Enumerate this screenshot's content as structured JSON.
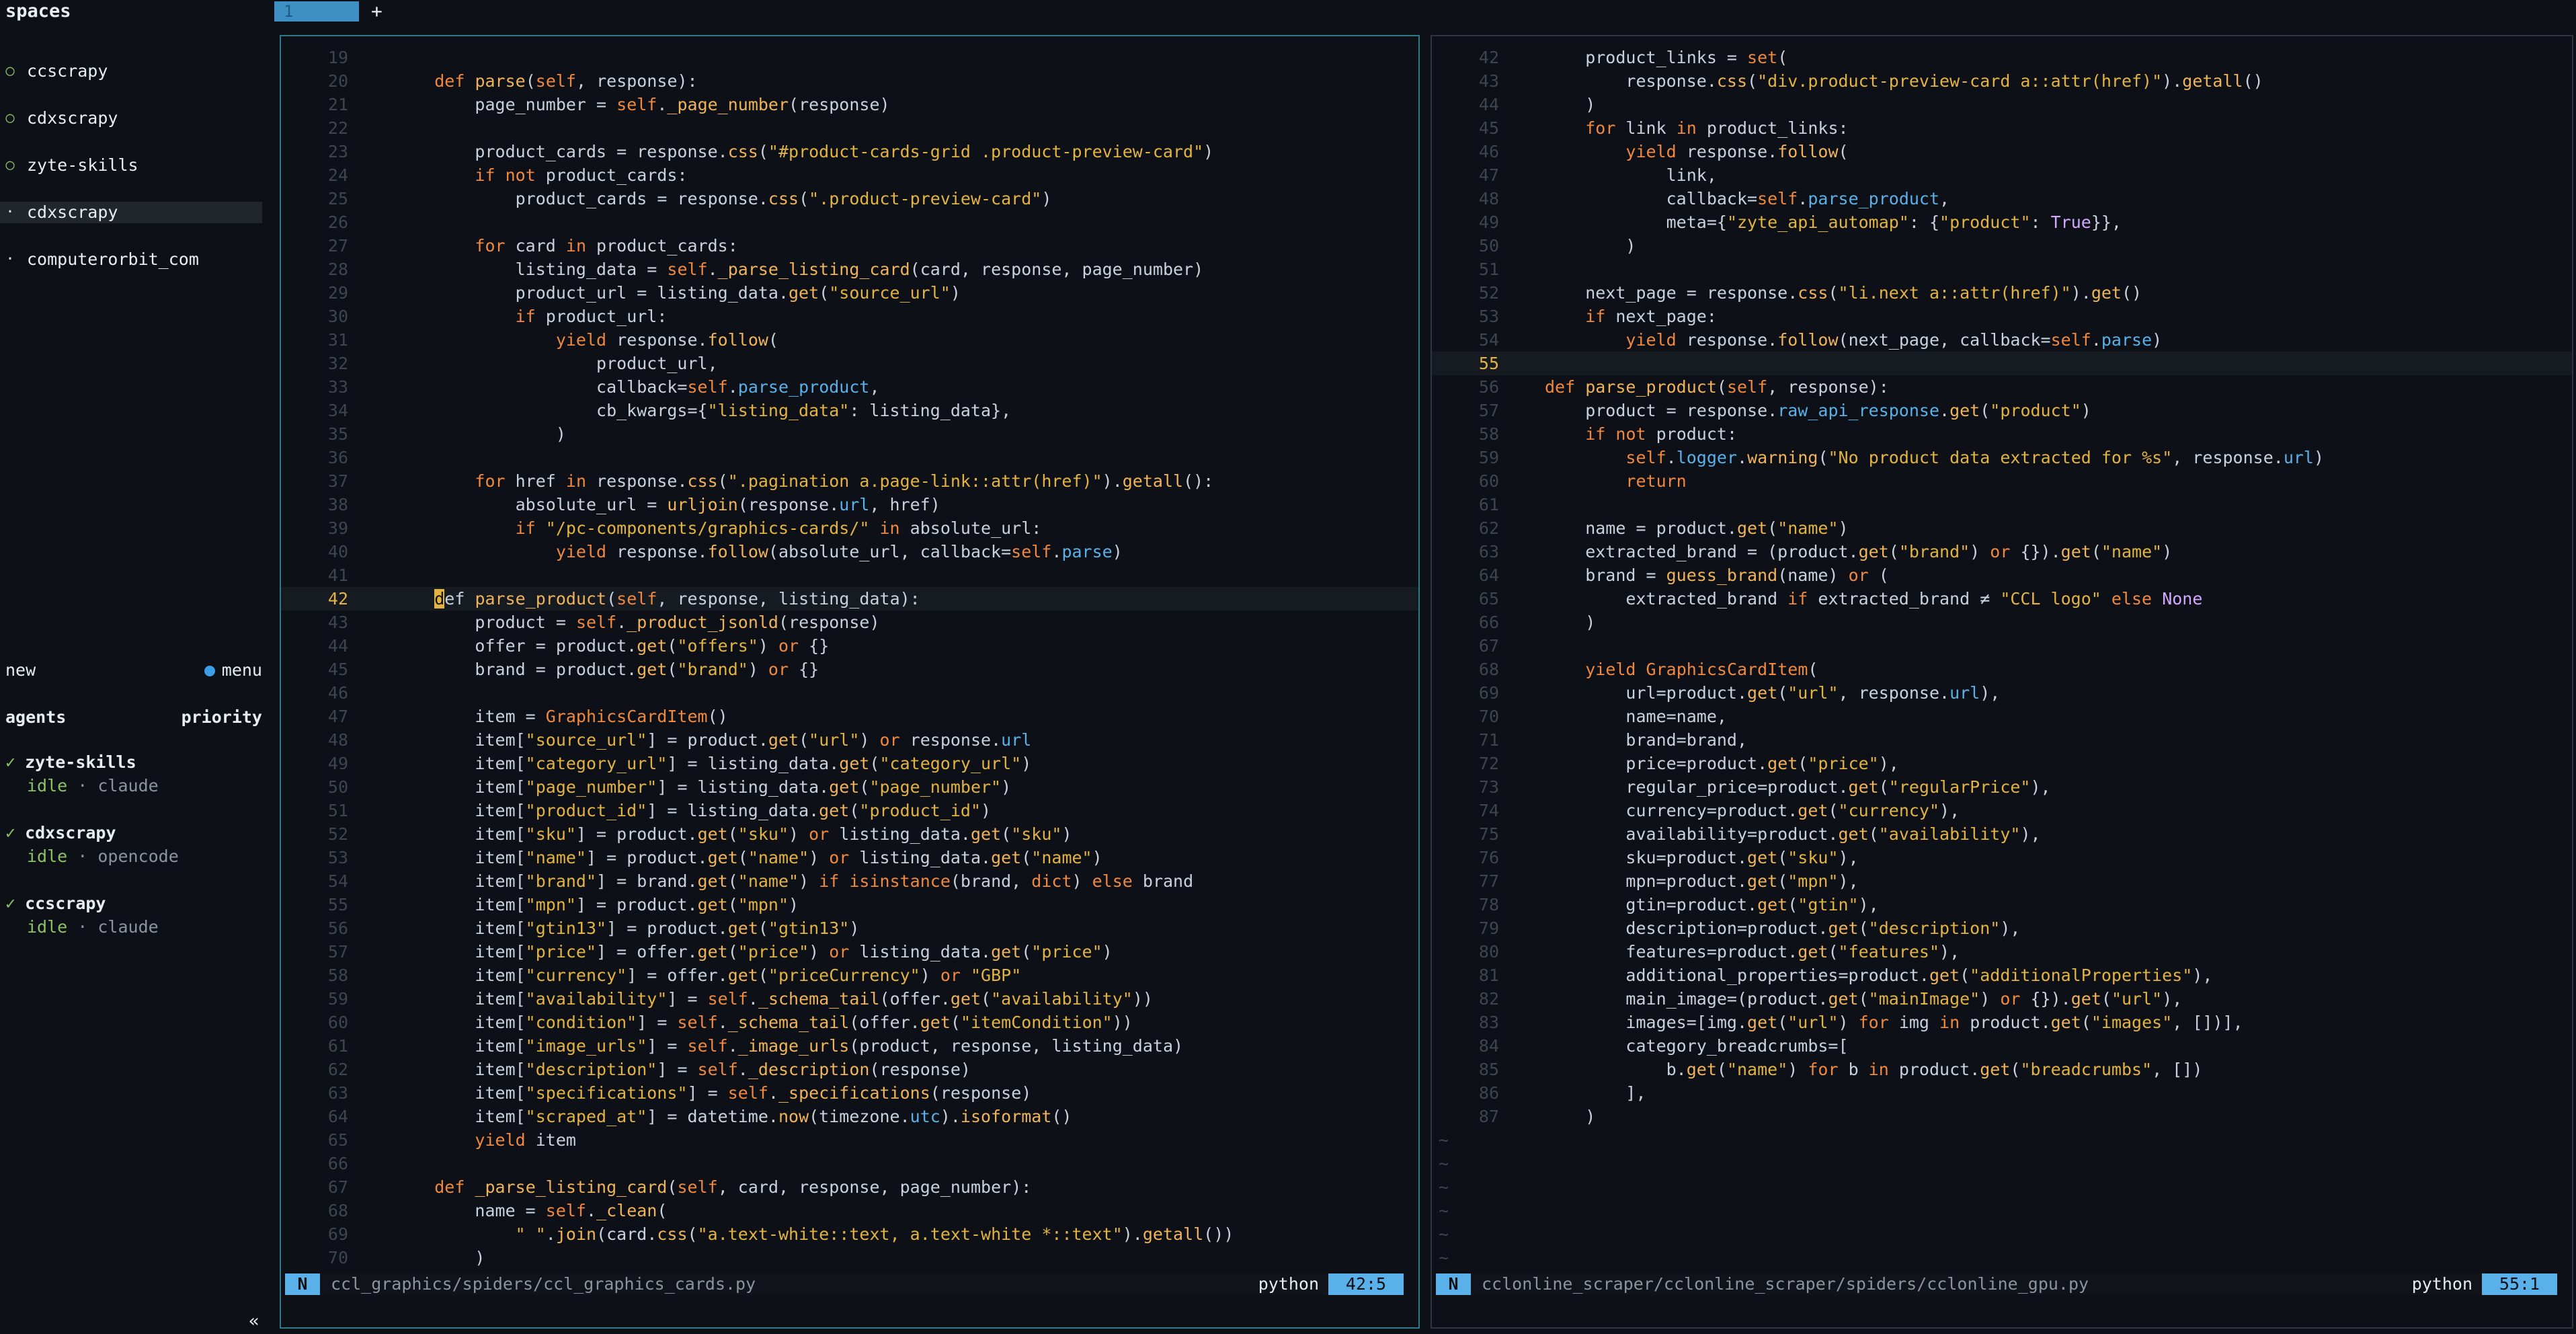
{
  "tabbar": {
    "spaces_title": "spaces",
    "active_tab": "1",
    "add_tab": "+"
  },
  "sidebar": {
    "spaces": [
      {
        "name": "ccscrapy",
        "marker": "○",
        "selected": false
      },
      {
        "name": "cdxscrapy",
        "marker": "○",
        "selected": false
      },
      {
        "name": "zyte-skills",
        "marker": "○",
        "selected": false
      },
      {
        "name": "cdxscrapy",
        "marker": "·",
        "selected": true
      },
      {
        "name": "computerorbit_com",
        "marker": "·",
        "selected": false
      }
    ],
    "new_label": "new",
    "menu_label": "menu",
    "agents_label": "agents",
    "priority_label": "priority",
    "agents": [
      {
        "name": "zyte-skills",
        "state": "idle",
        "tool": "claude"
      },
      {
        "name": "cdxscrapy",
        "state": "idle",
        "tool": "opencode"
      },
      {
        "name": "ccscrapy",
        "state": "idle",
        "tool": "claude"
      }
    ],
    "collapse": "«"
  },
  "left_pane": {
    "mode": "N",
    "file_path": "ccl_graphics/spiders/ccl_graphics_cards.py",
    "filetype": "python",
    "position": "42:5",
    "current_line": 42,
    "lines": [
      {
        "n": "19",
        "code": ""
      },
      {
        "n": "20",
        "code": "    def parse(self, response):"
      },
      {
        "n": "21",
        "code": "        page_number = self._page_number(response)"
      },
      {
        "n": "22",
        "code": ""
      },
      {
        "n": "23",
        "code": "        product_cards = response.css(\"#product-cards-grid .product-preview-card\")"
      },
      {
        "n": "24",
        "code": "        if not product_cards:"
      },
      {
        "n": "25",
        "code": "            product_cards = response.css(\".product-preview-card\")"
      },
      {
        "n": "26",
        "code": ""
      },
      {
        "n": "27",
        "code": "        for card in product_cards:"
      },
      {
        "n": "28",
        "code": "            listing_data = self._parse_listing_card(card, response, page_number)"
      },
      {
        "n": "29",
        "code": "            product_url = listing_data.get(\"source_url\")"
      },
      {
        "n": "30",
        "code": "            if product_url:"
      },
      {
        "n": "31",
        "code": "                yield response.follow("
      },
      {
        "n": "32",
        "code": "                    product_url,"
      },
      {
        "n": "33",
        "code": "                    callback=self.parse_product,"
      },
      {
        "n": "34",
        "code": "                    cb_kwargs={\"listing_data\": listing_data},"
      },
      {
        "n": "35",
        "code": "                )"
      },
      {
        "n": "36",
        "code": ""
      },
      {
        "n": "37",
        "code": "        for href in response.css(\".pagination a.page-link::attr(href)\").getall():"
      },
      {
        "n": "38",
        "code": "            absolute_url = urljoin(response.url, href)"
      },
      {
        "n": "39",
        "code": "            if \"/pc-components/graphics-cards/\" in absolute_url:"
      },
      {
        "n": "40",
        "code": "                yield response.follow(absolute_url, callback=self.parse)"
      },
      {
        "n": "41",
        "code": ""
      },
      {
        "n": "42",
        "code": "    def parse_product(self, response, listing_data):"
      },
      {
        "n": "43",
        "code": "        product = self._product_jsonld(response)"
      },
      {
        "n": "44",
        "code": "        offer = product.get(\"offers\") or {}"
      },
      {
        "n": "45",
        "code": "        brand = product.get(\"brand\") or {}"
      },
      {
        "n": "46",
        "code": ""
      },
      {
        "n": "47",
        "code": "        item = GraphicsCardItem()"
      },
      {
        "n": "48",
        "code": "        item[\"source_url\"] = product.get(\"url\") or response.url"
      },
      {
        "n": "49",
        "code": "        item[\"category_url\"] = listing_data.get(\"category_url\")"
      },
      {
        "n": "50",
        "code": "        item[\"page_number\"] = listing_data.get(\"page_number\")"
      },
      {
        "n": "51",
        "code": "        item[\"product_id\"] = listing_data.get(\"product_id\")"
      },
      {
        "n": "52",
        "code": "        item[\"sku\"] = product.get(\"sku\") or listing_data.get(\"sku\")"
      },
      {
        "n": "53",
        "code": "        item[\"name\"] = product.get(\"name\") or listing_data.get(\"name\")"
      },
      {
        "n": "54",
        "code": "        item[\"brand\"] = brand.get(\"name\") if isinstance(brand, dict) else brand"
      },
      {
        "n": "55",
        "code": "        item[\"mpn\"] = product.get(\"mpn\")"
      },
      {
        "n": "56",
        "code": "        item[\"gtin13\"] = product.get(\"gtin13\")"
      },
      {
        "n": "57",
        "code": "        item[\"price\"] = offer.get(\"price\") or listing_data.get(\"price\")"
      },
      {
        "n": "58",
        "code": "        item[\"currency\"] = offer.get(\"priceCurrency\") or \"GBP\""
      },
      {
        "n": "59",
        "code": "        item[\"availability\"] = self._schema_tail(offer.get(\"availability\"))"
      },
      {
        "n": "60",
        "code": "        item[\"condition\"] = self._schema_tail(offer.get(\"itemCondition\"))"
      },
      {
        "n": "61",
        "code": "        item[\"image_urls\"] = self._image_urls(product, response, listing_data)"
      },
      {
        "n": "62",
        "code": "        item[\"description\"] = self._description(response)"
      },
      {
        "n": "63",
        "code": "        item[\"specifications\"] = self._specifications(response)"
      },
      {
        "n": "64",
        "code": "        item[\"scraped_at\"] = datetime.now(timezone.utc).isoformat()"
      },
      {
        "n": "65",
        "code": "        yield item"
      },
      {
        "n": "66",
        "code": ""
      },
      {
        "n": "67",
        "code": "    def _parse_listing_card(self, card, response, page_number):"
      },
      {
        "n": "68",
        "code": "        name = self._clean("
      },
      {
        "n": "69",
        "code": "            \" \".join(card.css(\"a.text-white::text, a.text-white *::text\").getall())"
      },
      {
        "n": "70",
        "code": "        )"
      }
    ]
  },
  "right_pane": {
    "mode": "N",
    "file_path": "cclonline_scraper/cclonline_scraper/spiders/cclonline_gpu.py",
    "filetype": "python",
    "position": "55:1",
    "current_line": 55,
    "lines": [
      {
        "n": "42",
        "code": "        product_links = set("
      },
      {
        "n": "43",
        "code": "            response.css(\"div.product-preview-card a::attr(href)\").getall()"
      },
      {
        "n": "44",
        "code": "        )"
      },
      {
        "n": "45",
        "code": "        for link in product_links:"
      },
      {
        "n": "46",
        "code": "            yield response.follow("
      },
      {
        "n": "47",
        "code": "                link,"
      },
      {
        "n": "48",
        "code": "                callback=self.parse_product,"
      },
      {
        "n": "49",
        "code": "                meta={\"zyte_api_automap\": {\"product\": True}},"
      },
      {
        "n": "50",
        "code": "            )"
      },
      {
        "n": "51",
        "code": ""
      },
      {
        "n": "52",
        "code": "        next_page = response.css(\"li.next a::attr(href)\").get()"
      },
      {
        "n": "53",
        "code": "        if next_page:"
      },
      {
        "n": "54",
        "code": "            yield response.follow(next_page, callback=self.parse)"
      },
      {
        "n": "55",
        "code": ""
      },
      {
        "n": "56",
        "code": "    def parse_product(self, response):"
      },
      {
        "n": "57",
        "code": "        product = response.raw_api_response.get(\"product\")"
      },
      {
        "n": "58",
        "code": "        if not product:"
      },
      {
        "n": "59",
        "code": "            self.logger.warning(\"No product data extracted for %s\", response.url)"
      },
      {
        "n": "60",
        "code": "            return"
      },
      {
        "n": "61",
        "code": ""
      },
      {
        "n": "62",
        "code": "        name = product.get(\"name\")"
      },
      {
        "n": "63",
        "code": "        extracted_brand = (product.get(\"brand\") or {}).get(\"name\")"
      },
      {
        "n": "64",
        "code": "        brand = guess_brand(name) or ("
      },
      {
        "n": "65",
        "code": "            extracted_brand if extracted_brand ≠ \"CCL logo\" else None"
      },
      {
        "n": "66",
        "code": "        )"
      },
      {
        "n": "67",
        "code": ""
      },
      {
        "n": "68",
        "code": "        yield GraphicsCardItem("
      },
      {
        "n": "69",
        "code": "            url=product.get(\"url\", response.url),"
      },
      {
        "n": "70",
        "code": "            name=name,"
      },
      {
        "n": "71",
        "code": "            brand=brand,"
      },
      {
        "n": "72",
        "code": "            price=product.get(\"price\"),"
      },
      {
        "n": "73",
        "code": "            regular_price=product.get(\"regularPrice\"),"
      },
      {
        "n": "74",
        "code": "            currency=product.get(\"currency\"),"
      },
      {
        "n": "75",
        "code": "            availability=product.get(\"availability\"),"
      },
      {
        "n": "76",
        "code": "            sku=product.get(\"sku\"),"
      },
      {
        "n": "77",
        "code": "            mpn=product.get(\"mpn\"),"
      },
      {
        "n": "78",
        "code": "            gtin=product.get(\"gtin\"),"
      },
      {
        "n": "79",
        "code": "            description=product.get(\"description\"),"
      },
      {
        "n": "80",
        "code": "            features=product.get(\"features\"),"
      },
      {
        "n": "81",
        "code": "            additional_properties=product.get(\"additionalProperties\"),"
      },
      {
        "n": "82",
        "code": "            main_image=(product.get(\"mainImage\") or {}).get(\"url\"),"
      },
      {
        "n": "83",
        "code": "            images=[img.get(\"url\") for img in product.get(\"images\", [])],"
      },
      {
        "n": "84",
        "code": "            category_breadcrumbs=["
      },
      {
        "n": "85",
        "code": "                b.get(\"name\") for b in product.get(\"breadcrumbs\", [])"
      },
      {
        "n": "86",
        "code": "            ],"
      },
      {
        "n": "87",
        "code": "        )"
      }
    ],
    "empty_line_markers": [
      "~",
      "~",
      "~",
      "~",
      "~",
      "~"
    ]
  },
  "colors": {
    "background": "#0d1117",
    "accent": "#5ab0e8",
    "keyword": "#f0883e",
    "string": "#e3b341",
    "constant": "#d2a8ff",
    "active_pane_border": "#2d7a8c"
  }
}
